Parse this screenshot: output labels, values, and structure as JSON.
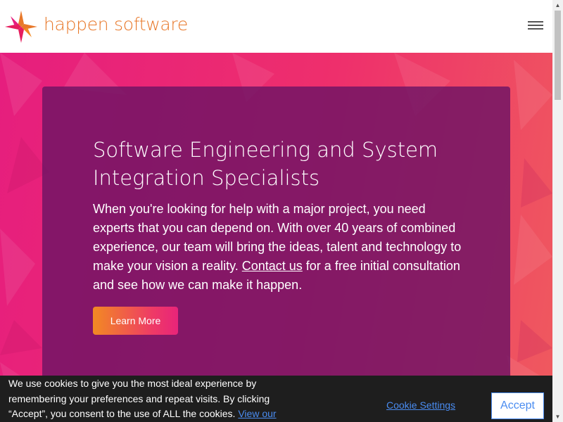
{
  "header": {
    "brand": "happen software",
    "logo_colors": [
      "#e61e7e",
      "#f28a23"
    ]
  },
  "hero": {
    "title": "Software Engineering and System Integration Specialists",
    "body_before": "When you're looking for help with a major project, you need experts that you can depend on. With over 40 years of combined experience, our team will bring the ideas, talent and technology to make your vision a reality. ",
    "contact_link": "Contact us",
    "body_after": " for a free initial consultation and see how we can make it happen.",
    "button_label": "Learn More"
  },
  "cookie": {
    "text": "We use cookies to give you the most ideal experience by remembering your preferences and repeat visits. By clicking “Accept”, you consent to the use of ALL the cookies. ",
    "link_text": "View our",
    "settings_label": "Cookie Settings",
    "accept_label": "Accept"
  },
  "scrollbar": {
    "up_icon": "▲",
    "down_icon": "▼"
  }
}
